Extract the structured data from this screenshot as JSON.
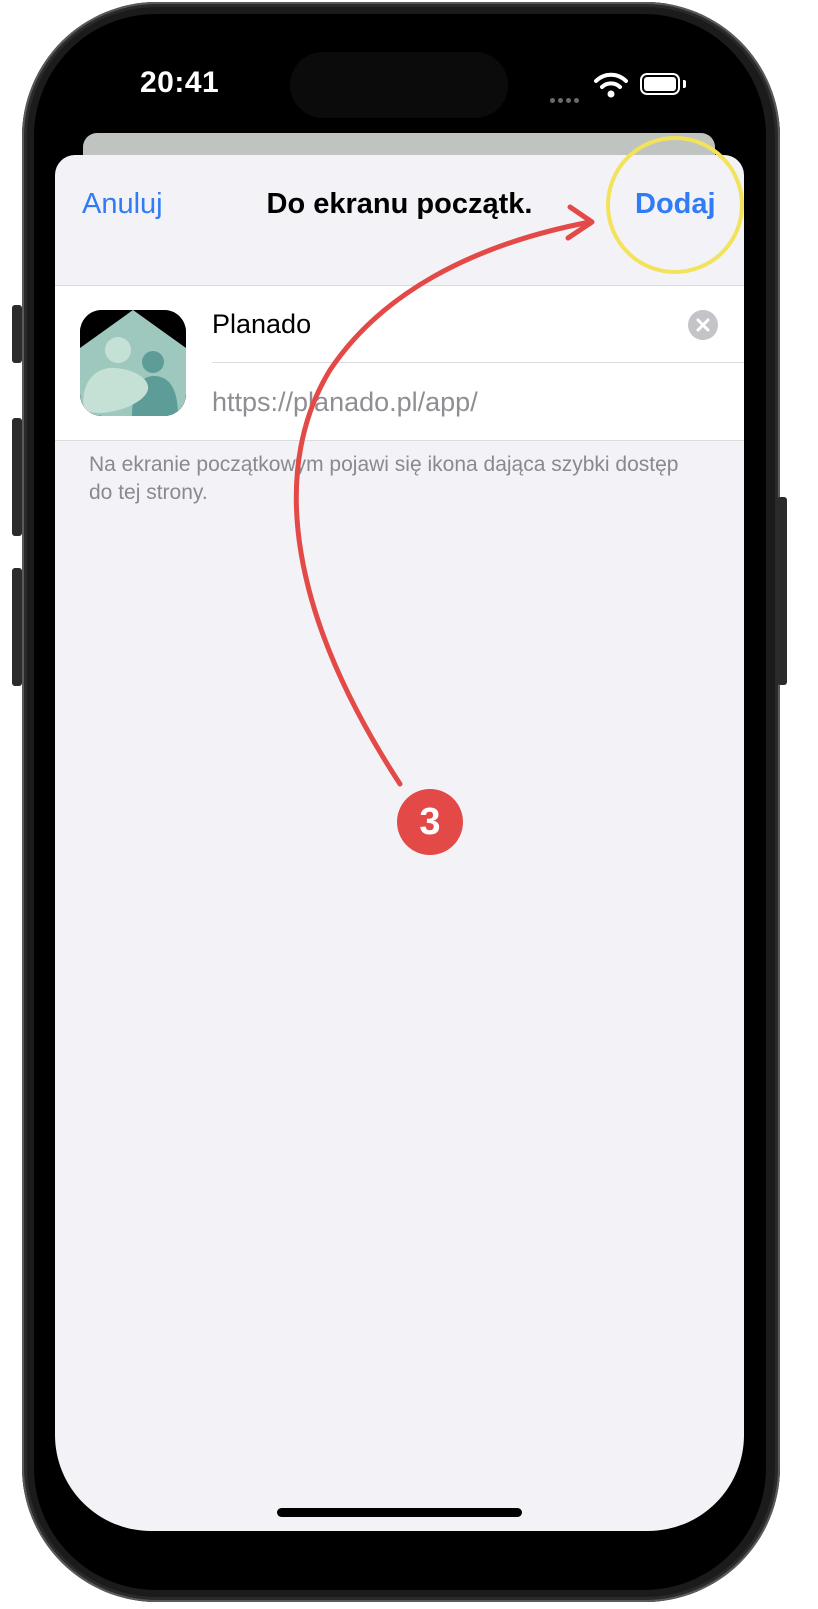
{
  "status_bar": {
    "time": "20:41"
  },
  "nav": {
    "cancel_label": "Anuluj",
    "title": "Do ekranu początk.",
    "add_label": "Dodaj"
  },
  "form": {
    "name_value": "Planado",
    "url_value": "https://planado.pl/app/"
  },
  "footnote": "Na ekranie początkowym pojawi się ikona dająca szybki dostęp do tej strony.",
  "annotation": {
    "step_number": "3"
  },
  "colors": {
    "accent": "#2f7cf6",
    "annotation_arrow": "#e34a47",
    "highlight_circle": "#f3e35a",
    "sheet_background": "#f2f2f7"
  },
  "icons": [
    "wifi-icon",
    "battery-icon",
    "clear-icon",
    "app-icon"
  ]
}
